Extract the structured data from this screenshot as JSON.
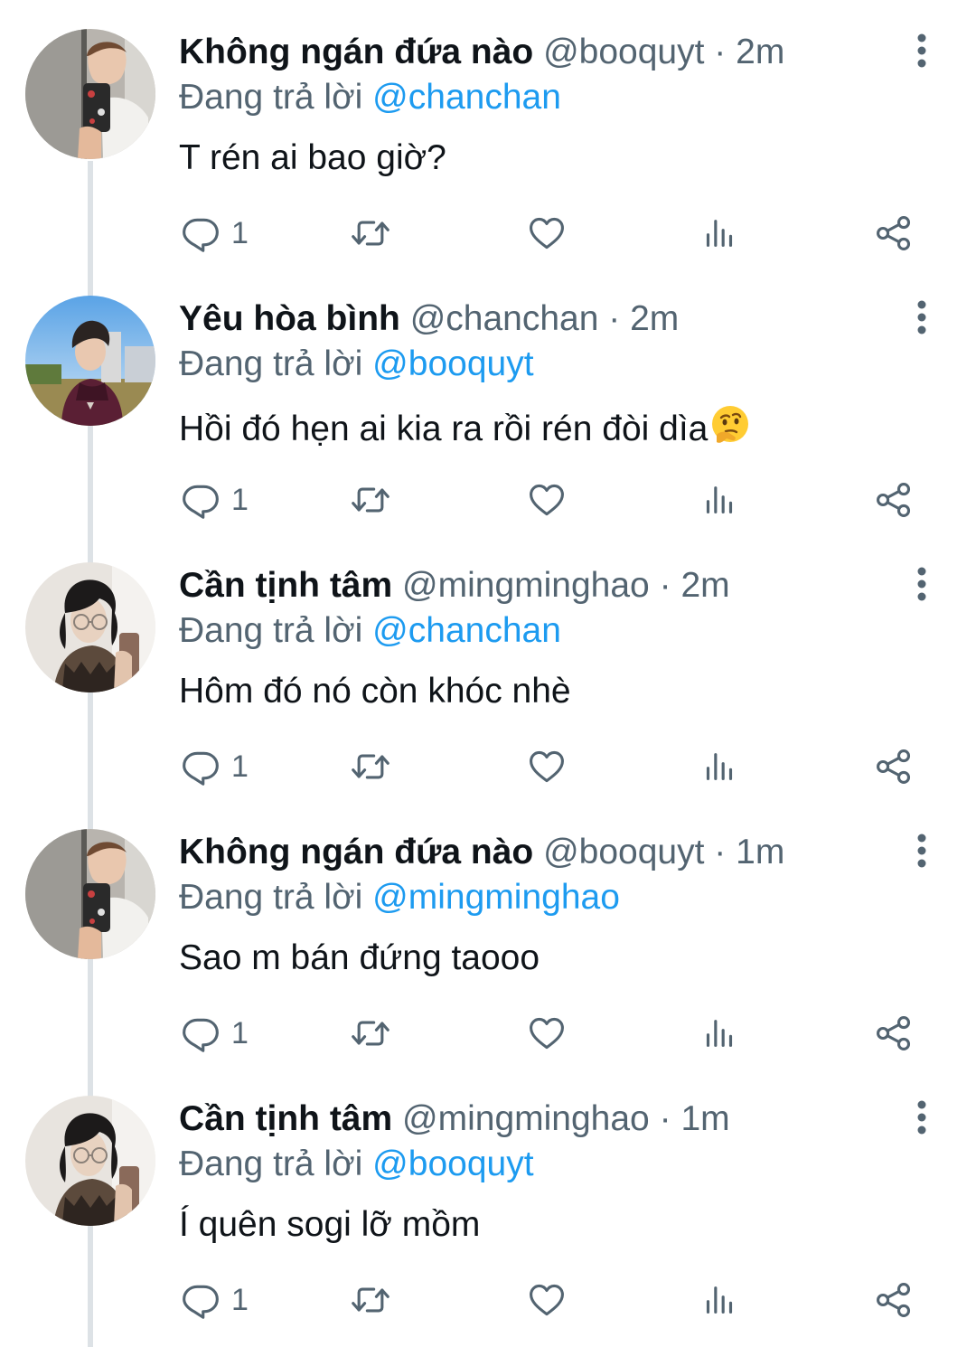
{
  "reply_prefix": "Đang trả lời",
  "tweets": [
    {
      "name": "Không ngán đứa nào",
      "handle": "@booquyt",
      "sep": "·",
      "time": "2m",
      "reply_to": "@chanchan",
      "text": "T rén ai bao giờ?",
      "replies": "1",
      "avatar": "avatar-booquyt"
    },
    {
      "name": "Yêu hòa bình",
      "handle": "@chanchan",
      "sep": "·",
      "time": "2m",
      "reply_to": "@booquyt",
      "text": "Hồi đó hẹn ai kia ra rồi rén đòi dìa",
      "emoji": "thinking-face-emoji",
      "replies": "1",
      "avatar": "avatar-chanchan"
    },
    {
      "name": "Cần tịnh tâm",
      "handle": "@mingminghao",
      "sep": "·",
      "time": "2m",
      "reply_to": "@chanchan",
      "text": "Hôm đó nó còn khóc nhè",
      "replies": "1",
      "avatar": "avatar-mingminghao"
    },
    {
      "name": "Không ngán đứa nào",
      "handle": "@booquyt",
      "sep": "·",
      "time": "1m",
      "reply_to": "@mingminghao",
      "text": "Sao m bán đứng taooo",
      "replies": "1",
      "avatar": "avatar-booquyt"
    },
    {
      "name": "Cần tịnh tâm",
      "handle": "@mingminghao",
      "sep": "·",
      "time": "1m",
      "reply_to": "@booquyt",
      "text": "Í quên sogi lỡ mồm",
      "replies": "1",
      "avatar": "avatar-mingminghao"
    }
  ],
  "icons": [
    "reply-icon",
    "retweet-icon",
    "like-icon",
    "views-icon",
    "share-icon",
    "more-icon"
  ],
  "colors": {
    "name": "#0f1419",
    "muted": "#536471",
    "mention": "#1d9bf0",
    "thread_line": "#dde2e6"
  }
}
